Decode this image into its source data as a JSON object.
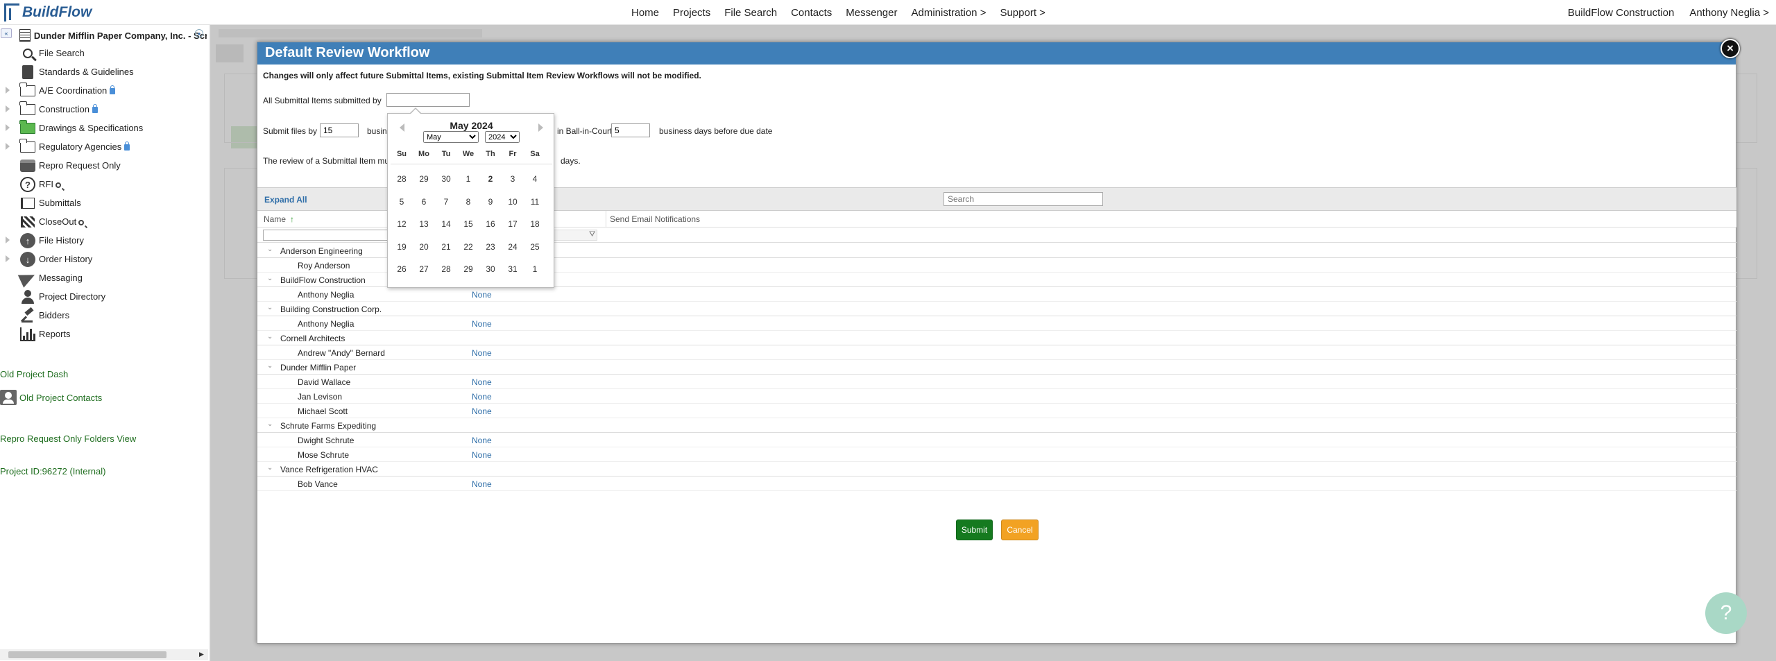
{
  "app": {
    "logo_text": "BuildFlow"
  },
  "nav": {
    "center": [
      "Home",
      "Projects",
      "File Search",
      "Contacts",
      "Messenger",
      "Administration >",
      "Support >"
    ],
    "right": [
      "BuildFlow Construction",
      "Anthony Neglia >"
    ]
  },
  "sidebar": {
    "collapse_glyph": "«",
    "company": "Dunder Mifflin Paper Company, Inc. - Scr",
    "items": [
      {
        "label": "File Search",
        "icon": "search-icon",
        "expand": false,
        "lock": false,
        "mag": false
      },
      {
        "label": "Standards & Guidelines",
        "icon": "book-icon",
        "expand": false,
        "lock": false,
        "mag": false
      },
      {
        "label": "A/E Coordination",
        "icon": "folder-icon",
        "expand": true,
        "lock": true,
        "mag": false
      },
      {
        "label": "Construction",
        "icon": "folder-icon",
        "expand": true,
        "lock": true,
        "mag": false
      },
      {
        "label": "Drawings & Specifications",
        "icon": "folder-green-icon",
        "expand": true,
        "lock": false,
        "mag": false
      },
      {
        "label": "Regulatory Agencies",
        "icon": "folder-icon",
        "expand": true,
        "lock": true,
        "mag": false
      },
      {
        "label": "Repro Request Only",
        "icon": "printer-icon",
        "expand": false,
        "lock": false,
        "mag": false
      },
      {
        "label": "RFI",
        "icon": "question-icon",
        "expand": false,
        "lock": false,
        "mag": true
      },
      {
        "label": "Submittals",
        "icon": "flag-icon",
        "expand": false,
        "lock": false,
        "mag": false
      },
      {
        "label": "CloseOut",
        "icon": "checkered-flag-icon",
        "expand": false,
        "lock": false,
        "mag": true
      },
      {
        "label": "File History",
        "icon": "upload-circle-icon",
        "expand": true,
        "lock": false,
        "mag": false
      },
      {
        "label": "Order History",
        "icon": "download-circle-icon",
        "expand": true,
        "lock": false,
        "mag": false
      },
      {
        "label": "Messaging",
        "icon": "paper-plane-icon",
        "expand": false,
        "lock": false,
        "mag": false
      },
      {
        "label": "Project Directory",
        "icon": "person-icon",
        "expand": false,
        "lock": false,
        "mag": false
      },
      {
        "label": "Bidders",
        "icon": "gavel-icon",
        "expand": false,
        "lock": false,
        "mag": false
      },
      {
        "label": "Reports",
        "icon": "bar-chart-icon",
        "expand": false,
        "lock": false,
        "mag": false
      }
    ],
    "old_project_dash": "Old Project Dash",
    "old_project_contacts": "Old Project Contacts",
    "repro_folders_view": "Repro Request Only Folders View",
    "project_id": "Project ID:96272 (Internal)"
  },
  "modal": {
    "title": "Default Review Workflow",
    "close_glyph": "×",
    "notice": "Changes will only affect future Submittal Items, existing Submittal Item Review Workflows will not be modified.",
    "submitted_by_label": "All Submittal Items submitted by",
    "submitted_by_value": "",
    "submit_files_by_label": "Submit files by",
    "submit_files_by_value": "15",
    "busin_fragment": "busin",
    "ball_in_court_label": "in Ball-in-Court",
    "ball_in_court_value": "5",
    "business_days_before": "business days before due date",
    "review_text": "The review of a Submittal Item mu",
    "review_text_end": "days.",
    "expand_all": "Expand All",
    "search_placeholder": "Search",
    "col_name": "Name",
    "col_email": "Send Email Notifications",
    "sort_glyph": "↑",
    "filter_glyph": "⛛",
    "submit": "Submit",
    "cancel": "Cancel",
    "groups": [
      {
        "name": "Anderson Engineering",
        "members": [
          {
            "name": "Roy Anderson",
            "email": ""
          }
        ]
      },
      {
        "name": "BuildFlow Construction",
        "members": [
          {
            "name": "Anthony Neglia",
            "email": "None"
          }
        ]
      },
      {
        "name": "Building Construction Corp.",
        "members": [
          {
            "name": "Anthony Neglia",
            "email": "None"
          }
        ]
      },
      {
        "name": "Cornell Architects",
        "members": [
          {
            "name": "Andrew \"Andy\" Bernard",
            "email": "None"
          }
        ]
      },
      {
        "name": "Dunder Mifflin Paper",
        "members": [
          {
            "name": "David Wallace",
            "email": "None"
          },
          {
            "name": "Jan Levison",
            "email": "None"
          },
          {
            "name": "Michael Scott",
            "email": "None"
          }
        ]
      },
      {
        "name": "Schrute Farms Expediting",
        "members": [
          {
            "name": "Dwight Schrute",
            "email": "None"
          },
          {
            "name": "Mose Schrute",
            "email": "None"
          }
        ]
      },
      {
        "name": "Vance Refrigeration HVAC",
        "members": [
          {
            "name": "Bob Vance",
            "email": "None"
          }
        ]
      }
    ]
  },
  "calendar": {
    "title": "May 2024",
    "month_selected": "May",
    "year_selected": "2024",
    "dow": [
      "Su",
      "Mo",
      "Tu",
      "We",
      "Th",
      "Fr",
      "Sa"
    ],
    "weeks": [
      [
        "28",
        "29",
        "30",
        "1",
        "2",
        "3",
        "4"
      ],
      [
        "5",
        "6",
        "7",
        "8",
        "9",
        "10",
        "11"
      ],
      [
        "12",
        "13",
        "14",
        "15",
        "16",
        "17",
        "18"
      ],
      [
        "19",
        "20",
        "21",
        "22",
        "23",
        "24",
        "25"
      ],
      [
        "26",
        "27",
        "28",
        "29",
        "30",
        "31",
        "1"
      ]
    ],
    "today": "2"
  },
  "help_glyph": "?",
  "colors": {
    "header_blue": "#3f7fb8",
    "submit_green": "#157a1f",
    "cancel_orange": "#f2a223",
    "link_green": "#1f6e1f"
  }
}
